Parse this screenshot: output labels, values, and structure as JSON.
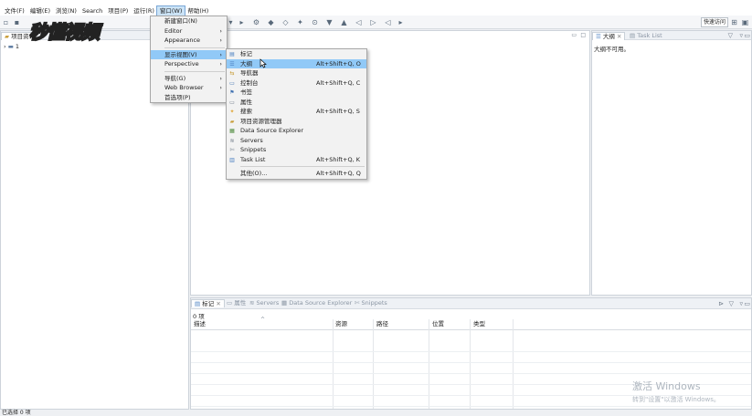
{
  "window": {
    "title": ""
  },
  "menubar": [
    "文件(F)",
    "编辑(E)",
    "浏览(N)",
    "Search",
    "项目(P)",
    "运行(R)",
    "窗口(W)",
    "帮助(H)"
  ],
  "menubar_active_index": 6,
  "toolbar": {
    "quick_access": "快速访问"
  },
  "logo_text": "秒懂视频",
  "left_panel": {
    "tab": "项目资",
    "tree_item": "1"
  },
  "window_menu": [
    {
      "label": "新建窗口(N)",
      "arrow": ""
    },
    {
      "label": "Editor",
      "arrow": "›"
    },
    {
      "label": "Appearance",
      "arrow": "›"
    },
    {
      "label": "显示视图(V)",
      "arrow": "›",
      "highlighted": true
    },
    {
      "label": "Perspective",
      "arrow": "›"
    },
    {
      "label": "导航(G)",
      "arrow": "›"
    },
    {
      "label": "Web Browser",
      "arrow": "›"
    },
    {
      "label": "首选项(P)",
      "arrow": ""
    }
  ],
  "show_view_menu": [
    {
      "label": "标记",
      "accel": "",
      "icon": "markers-icon"
    },
    {
      "label": "大纲",
      "accel": "Alt+Shift+Q, O",
      "icon": "outline-icon",
      "highlighted": true
    },
    {
      "label": "导航器",
      "accel": "",
      "icon": "navigator-icon"
    },
    {
      "label": "控制台",
      "accel": "Alt+Shift+Q, C",
      "icon": "console-icon"
    },
    {
      "label": "书签",
      "accel": "",
      "icon": "bookmarks-icon"
    },
    {
      "label": "属性",
      "accel": "",
      "icon": "properties-icon"
    },
    {
      "label": "搜索",
      "accel": "Alt+Shift+Q, S",
      "icon": "search-icon"
    },
    {
      "label": "项目资源管理器",
      "accel": "",
      "icon": "project-explorer-icon"
    },
    {
      "label": "Data Source Explorer",
      "accel": "",
      "icon": "data-source-icon"
    },
    {
      "label": "Servers",
      "accel": "",
      "icon": "servers-icon"
    },
    {
      "label": "Snippets",
      "accel": "",
      "icon": "snippets-icon"
    },
    {
      "label": "Task List",
      "accel": "Alt+Shift+Q, K",
      "icon": "task-list-icon"
    },
    {
      "label": "其他(O)...",
      "accel": "Alt+Shift+Q, Q",
      "icon": ""
    }
  ],
  "right_panel": {
    "tabs": [
      "大纲",
      "Task List"
    ],
    "message": "大纲不可用。"
  },
  "bottom_panel": {
    "tabs": [
      "标记",
      "属性",
      "Servers",
      "Data Source Explorer",
      "Snippets"
    ],
    "count": "0 项",
    "columns": [
      "描述",
      "资源",
      "路径",
      "位置",
      "类型"
    ]
  },
  "status": "已选择 0 项",
  "watermark": {
    "line1": "激活 Windows",
    "line2": "转到\"设置\"以激活 Windows。"
  }
}
